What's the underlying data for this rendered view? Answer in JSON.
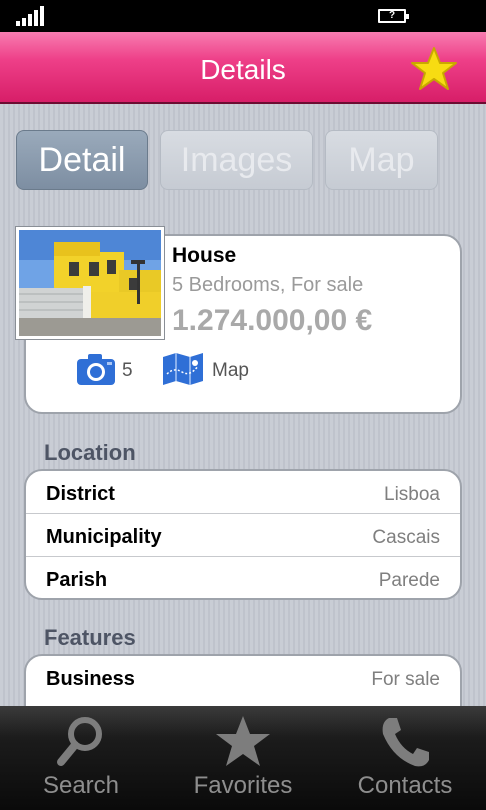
{
  "status": {
    "battery_label": "?"
  },
  "header": {
    "title": "Details",
    "favorite_icon": "star-icon"
  },
  "tabs": [
    {
      "label": "Detail",
      "active": true
    },
    {
      "label": "Images",
      "active": false
    },
    {
      "label": "Map",
      "active": false
    }
  ],
  "property": {
    "type": "House",
    "description": "5 Bedrooms, For sale",
    "price": "1.274.000,00 €",
    "photos_count": "5",
    "map_label": "Map"
  },
  "location": {
    "title": "Location",
    "rows": [
      {
        "key": "District",
        "value": "Lisboa"
      },
      {
        "key": "Municipality",
        "value": "Cascais"
      },
      {
        "key": "Parish",
        "value": "Parede"
      }
    ]
  },
  "features": {
    "title": "Features",
    "rows": [
      {
        "key": "Business",
        "value": "For sale"
      }
    ]
  },
  "bottom_nav": [
    {
      "label": "Search",
      "icon": "magnifier-icon"
    },
    {
      "label": "Favorites",
      "icon": "star-icon"
    },
    {
      "label": "Contacts",
      "icon": "phone-icon"
    }
  ],
  "colors": {
    "header_pink": "#e83a84",
    "star_yellow": "#f5d90a",
    "icon_blue": "#2f6fd6"
  }
}
